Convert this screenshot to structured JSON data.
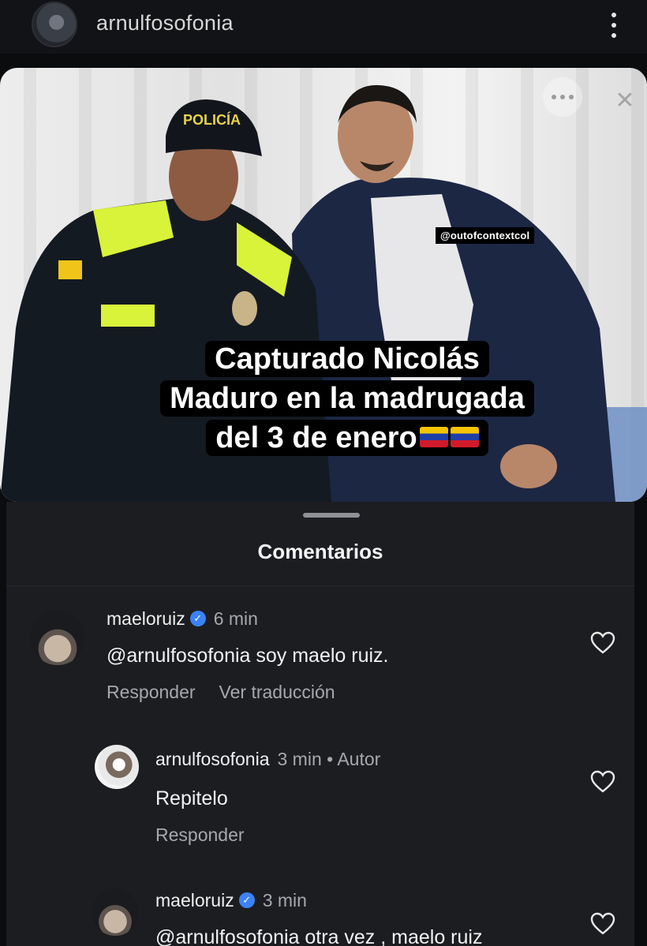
{
  "header": {
    "username": "arnulfosofonia"
  },
  "story": {
    "watermark": "@outofcontextcol",
    "caption_lines": [
      "Capturado Nicolás",
      "Maduro en la madrugada",
      "del 3 de enero"
    ],
    "cap_text": "POLICÍA",
    "flag_colors": [
      "#f4c400",
      "#1f3fa8",
      "#d11a2a"
    ]
  },
  "comments_sheet": {
    "title": "Comentarios",
    "comments": [
      {
        "username": "maeloruiz",
        "verified": true,
        "time": "6 min",
        "author_tag": "",
        "text": "@arnulfosofonia soy maelo ruiz.",
        "reply_label": "Responder",
        "translate_label": "Ver traducción"
      },
      {
        "username": "arnulfosofonia",
        "verified": false,
        "time": "3 min",
        "author_tag": "• Autor",
        "text": "Repitelo",
        "reply_label": "Responder",
        "translate_label": ""
      },
      {
        "username": "maeloruiz",
        "verified": true,
        "time": "3 min",
        "author_tag": "",
        "text": "@arnulfosofonia otra vez , maelo ruiz",
        "reply_label": "",
        "translate_label": ""
      }
    ]
  },
  "colors": {
    "background": "#0b0c0e",
    "sheet": "#1c1d21",
    "verified": "#3b82f6",
    "muted_text": "#a7a8ad"
  }
}
